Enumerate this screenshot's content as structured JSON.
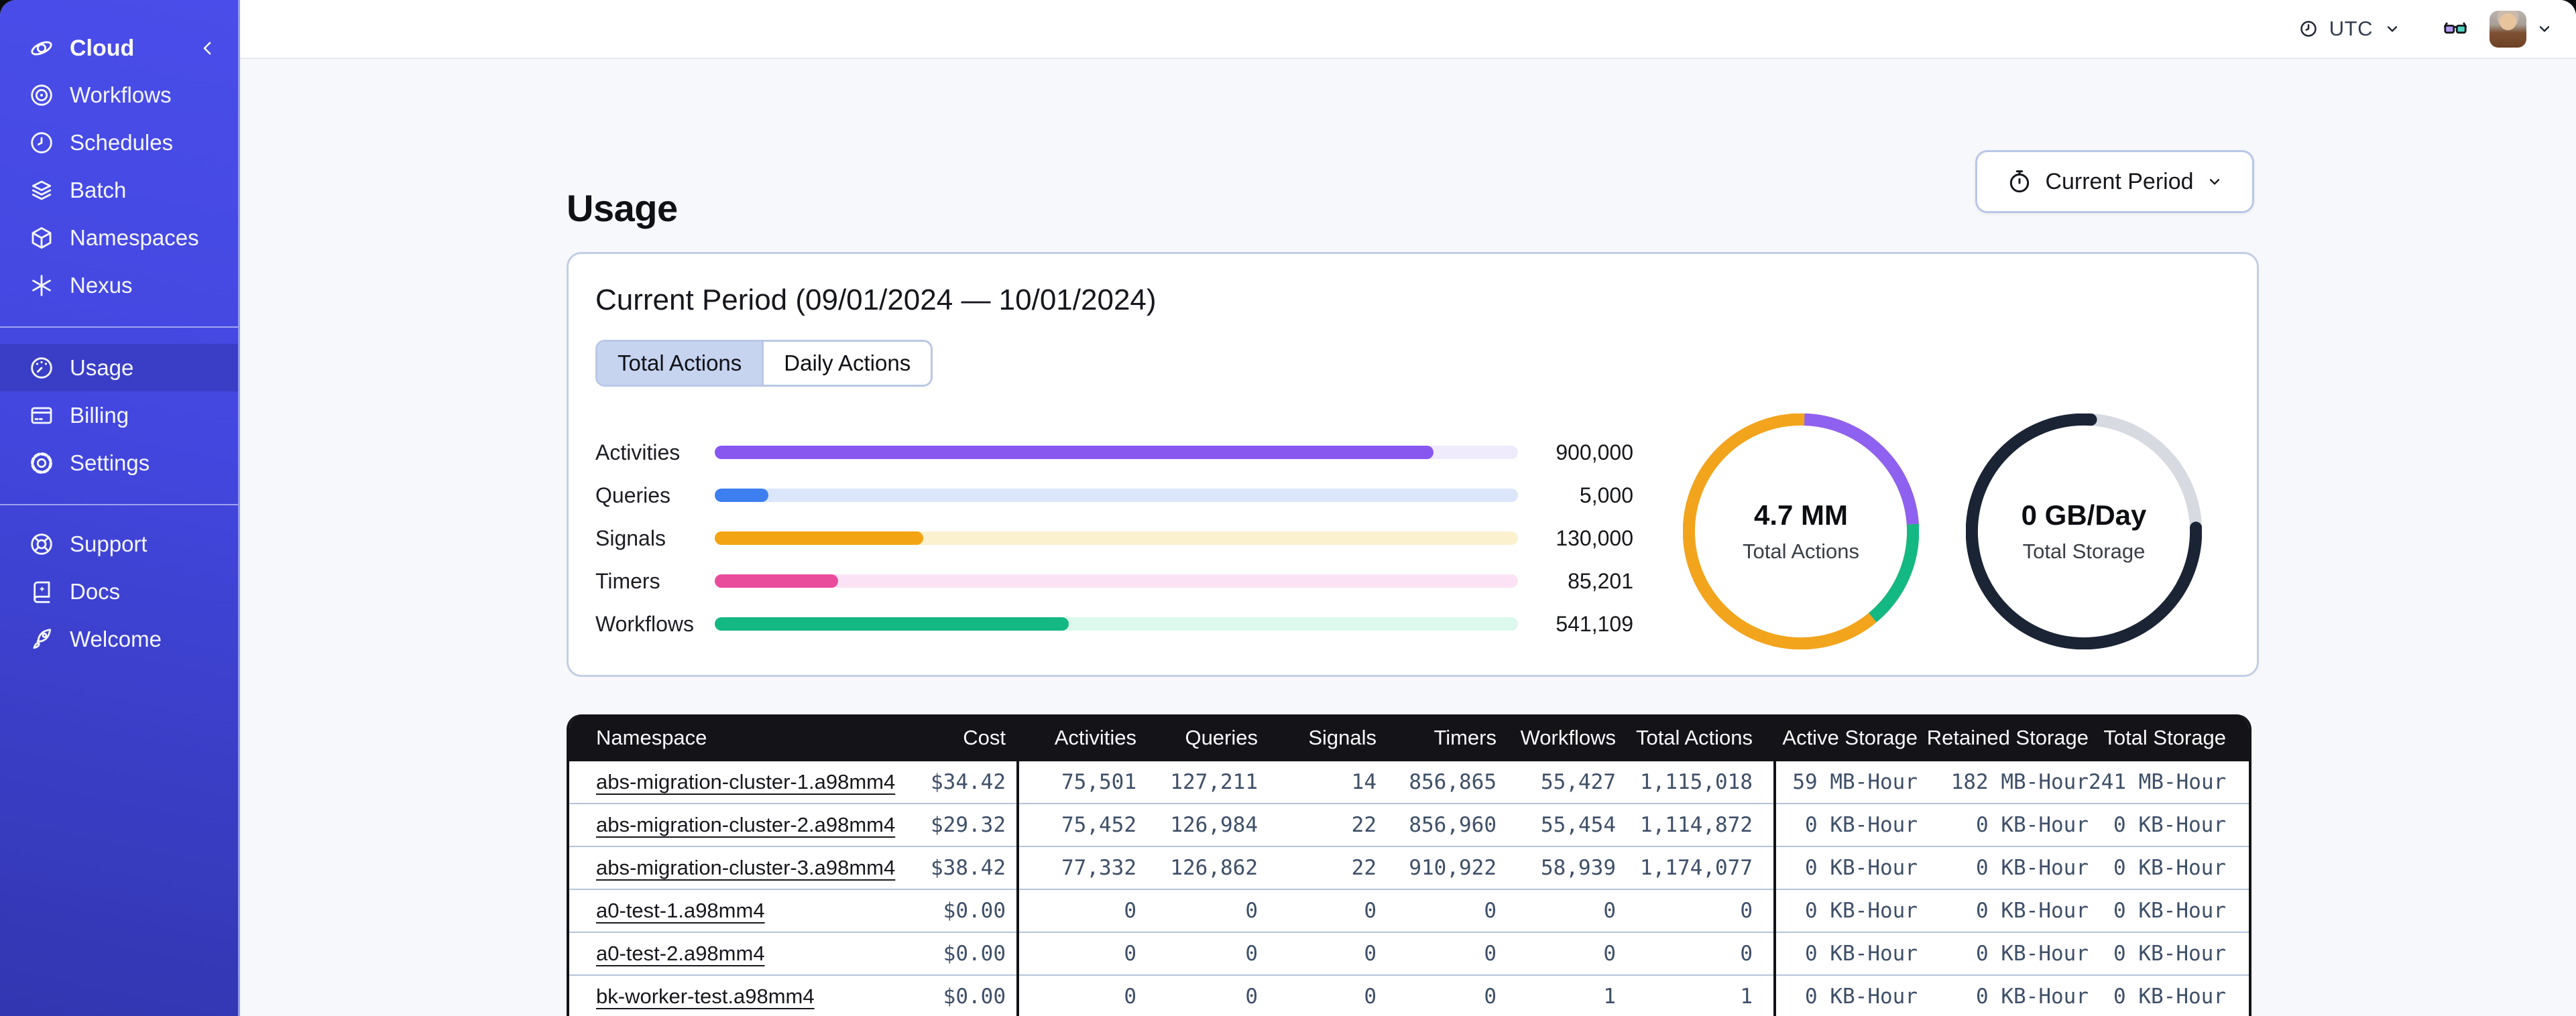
{
  "theme": {
    "sidebar_color": "#4347DF",
    "sidebar_active_color": "#3A3EC6",
    "table_header_color": "#141418",
    "card_border_color": "#C2CEE6",
    "selected_tab_color": "#C6D4F0"
  },
  "sidebar": {
    "header": {
      "icon": "cloud",
      "label": "Cloud"
    },
    "groups": [
      {
        "name": "nav",
        "items": [
          {
            "icon": "workflows",
            "label": "Workflows"
          },
          {
            "icon": "schedules",
            "label": "Schedules"
          },
          {
            "icon": "batch",
            "label": "Batch"
          },
          {
            "icon": "namespaces",
            "label": "Namespaces"
          },
          {
            "icon": "nexus",
            "label": "Nexus"
          }
        ]
      },
      {
        "name": "account",
        "items": [
          {
            "icon": "usage",
            "label": "Usage",
            "active": true
          },
          {
            "icon": "billing",
            "label": "Billing"
          },
          {
            "icon": "settings",
            "label": "Settings"
          }
        ]
      },
      {
        "name": "footer",
        "items": [
          {
            "icon": "support",
            "label": "Support"
          },
          {
            "icon": "docs",
            "label": "Docs"
          },
          {
            "icon": "welcome",
            "label": "Welcome"
          }
        ]
      }
    ]
  },
  "topbar": {
    "timezone": "UTC"
  },
  "page": {
    "title": "Usage",
    "period_button_label": "Current Period"
  },
  "usage_card": {
    "title": "Current Period (09/01/2024 — 10/01/2024)",
    "tabs": [
      {
        "label": "Total Actions",
        "active": true
      },
      {
        "label": "Daily Actions",
        "active": false
      }
    ]
  },
  "chart_data": [
    {
      "type": "bar",
      "orientation": "horizontal",
      "categories": [
        "Activities",
        "Queries",
        "Signals",
        "Timers",
        "Workflows"
      ],
      "values": [
        900000,
        5000,
        130000,
        85201,
        541109
      ],
      "value_labels": [
        "900,000",
        "5,000",
        "130,000",
        "85,201",
        "541,109"
      ],
      "fill_percent": [
        89.5,
        6.7,
        26.0,
        15.4,
        44.1
      ],
      "bar_colors": [
        "#8757F0",
        "#3D7FF0",
        "#F2A413",
        "#EA4C9C",
        "#14B883"
      ],
      "track_colors": [
        "#EFEAFC",
        "#DBE6FA",
        "#FCF1CF",
        "#FBE3F5",
        "#DDF8EC"
      ]
    },
    {
      "type": "donut",
      "center_value": "4.7 MM",
      "center_label": "Total Actions",
      "base_color": "#F2A41C",
      "arcs": [
        {
          "name": "purple-segment",
          "color": "#8F61F0",
          "start": 0.5,
          "length": 23.5
        },
        {
          "name": "green-segment",
          "color": "#14B883",
          "start": 24.0,
          "length": 15.0
        }
      ]
    },
    {
      "type": "donut",
      "center_value": "0 GB/Day",
      "center_label": "Total Storage",
      "base_color": "#D7DAE0",
      "arcs": [
        {
          "name": "dark-segment",
          "color": "#1B2435",
          "start": 24.5,
          "length": 76.5,
          "cap": "round"
        }
      ]
    }
  ],
  "table": {
    "columns": [
      "Namespace",
      "Cost",
      "Activities",
      "Queries",
      "Signals",
      "Timers",
      "Workflows",
      "Total Actions",
      "Active Storage",
      "Retained Storage",
      "Total Storage"
    ],
    "rows": [
      [
        "abs-migration-cluster-1.a98mm4",
        "$34.42",
        "75,501",
        "127,211",
        "14",
        "856,865",
        "55,427",
        "1,115,018",
        "59 MB-Hour",
        "182 MB-Hour",
        "241 MB-Hour"
      ],
      [
        "abs-migration-cluster-2.a98mm4",
        "$29.32",
        "75,452",
        "126,984",
        "22",
        "856,960",
        "55,454",
        "1,114,872",
        "0 KB-Hour",
        "0 KB-Hour",
        "0 KB-Hour"
      ],
      [
        "abs-migration-cluster-3.a98mm4",
        "$38.42",
        "77,332",
        "126,862",
        "22",
        "910,922",
        "58,939",
        "1,174,077",
        "0 KB-Hour",
        "0 KB-Hour",
        "0 KB-Hour"
      ],
      [
        "a0-test-1.a98mm4",
        "$0.00",
        "0",
        "0",
        "0",
        "0",
        "0",
        "0",
        "0 KB-Hour",
        "0 KB-Hour",
        "0 KB-Hour"
      ],
      [
        "a0-test-2.a98mm4",
        "$0.00",
        "0",
        "0",
        "0",
        "0",
        "0",
        "0",
        "0 KB-Hour",
        "0 KB-Hour",
        "0 KB-Hour"
      ],
      [
        "bk-worker-test.a98mm4",
        "$0.00",
        "0",
        "0",
        "0",
        "0",
        "1",
        "1",
        "0 KB-Hour",
        "0 KB-Hour",
        "0 KB-Hour"
      ]
    ]
  }
}
